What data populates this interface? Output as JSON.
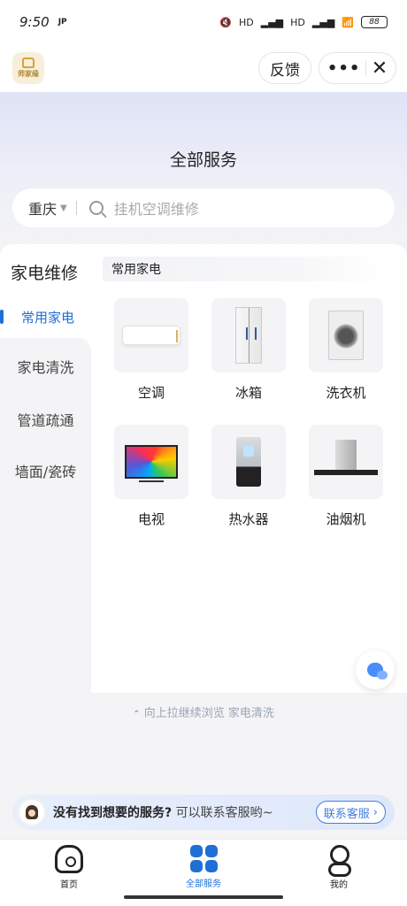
{
  "status_bar": {
    "time": "9:50",
    "indicator": "JP",
    "hd1": "HD",
    "hd2": "HD",
    "battery": "88"
  },
  "app_bar": {
    "logo_text": "师家缘",
    "feedback_label": "反馈",
    "more_label": "•••",
    "close_label": "✕"
  },
  "hero": {
    "title": "全部服务"
  },
  "search": {
    "city": "重庆",
    "placeholder": "挂机空调维修"
  },
  "sidebar": {
    "title": "家电维修",
    "items": [
      {
        "label": "常用家电",
        "active": true
      },
      {
        "label": "家电清洗"
      },
      {
        "label": "管道疏通"
      },
      {
        "label": "墙面/瓷砖"
      }
    ]
  },
  "section": {
    "label": "常用家电"
  },
  "tiles": [
    {
      "label": "空调",
      "icon": "air-conditioner"
    },
    {
      "label": "冰箱",
      "icon": "refrigerator"
    },
    {
      "label": "洗衣机",
      "icon": "washing-machine"
    },
    {
      "label": "电视",
      "icon": "television"
    },
    {
      "label": "热水器",
      "icon": "water-heater"
    },
    {
      "label": "油烟机",
      "icon": "range-hood"
    }
  ],
  "pull_hint": {
    "arrow": "⌃",
    "text": "向上拉继续浏览 家电清洗"
  },
  "cs_banner": {
    "bold": "没有找到想要的服务?",
    "rest": "可以联系客服哟~",
    "button": "联系客服",
    "chevron": "›"
  },
  "bottom_nav": [
    {
      "label": "首页"
    },
    {
      "label": "全部服务",
      "active": true
    },
    {
      "label": "我的"
    }
  ],
  "colors": {
    "accent": "#1f6fd6",
    "hero_top": "#dfe3f6"
  }
}
